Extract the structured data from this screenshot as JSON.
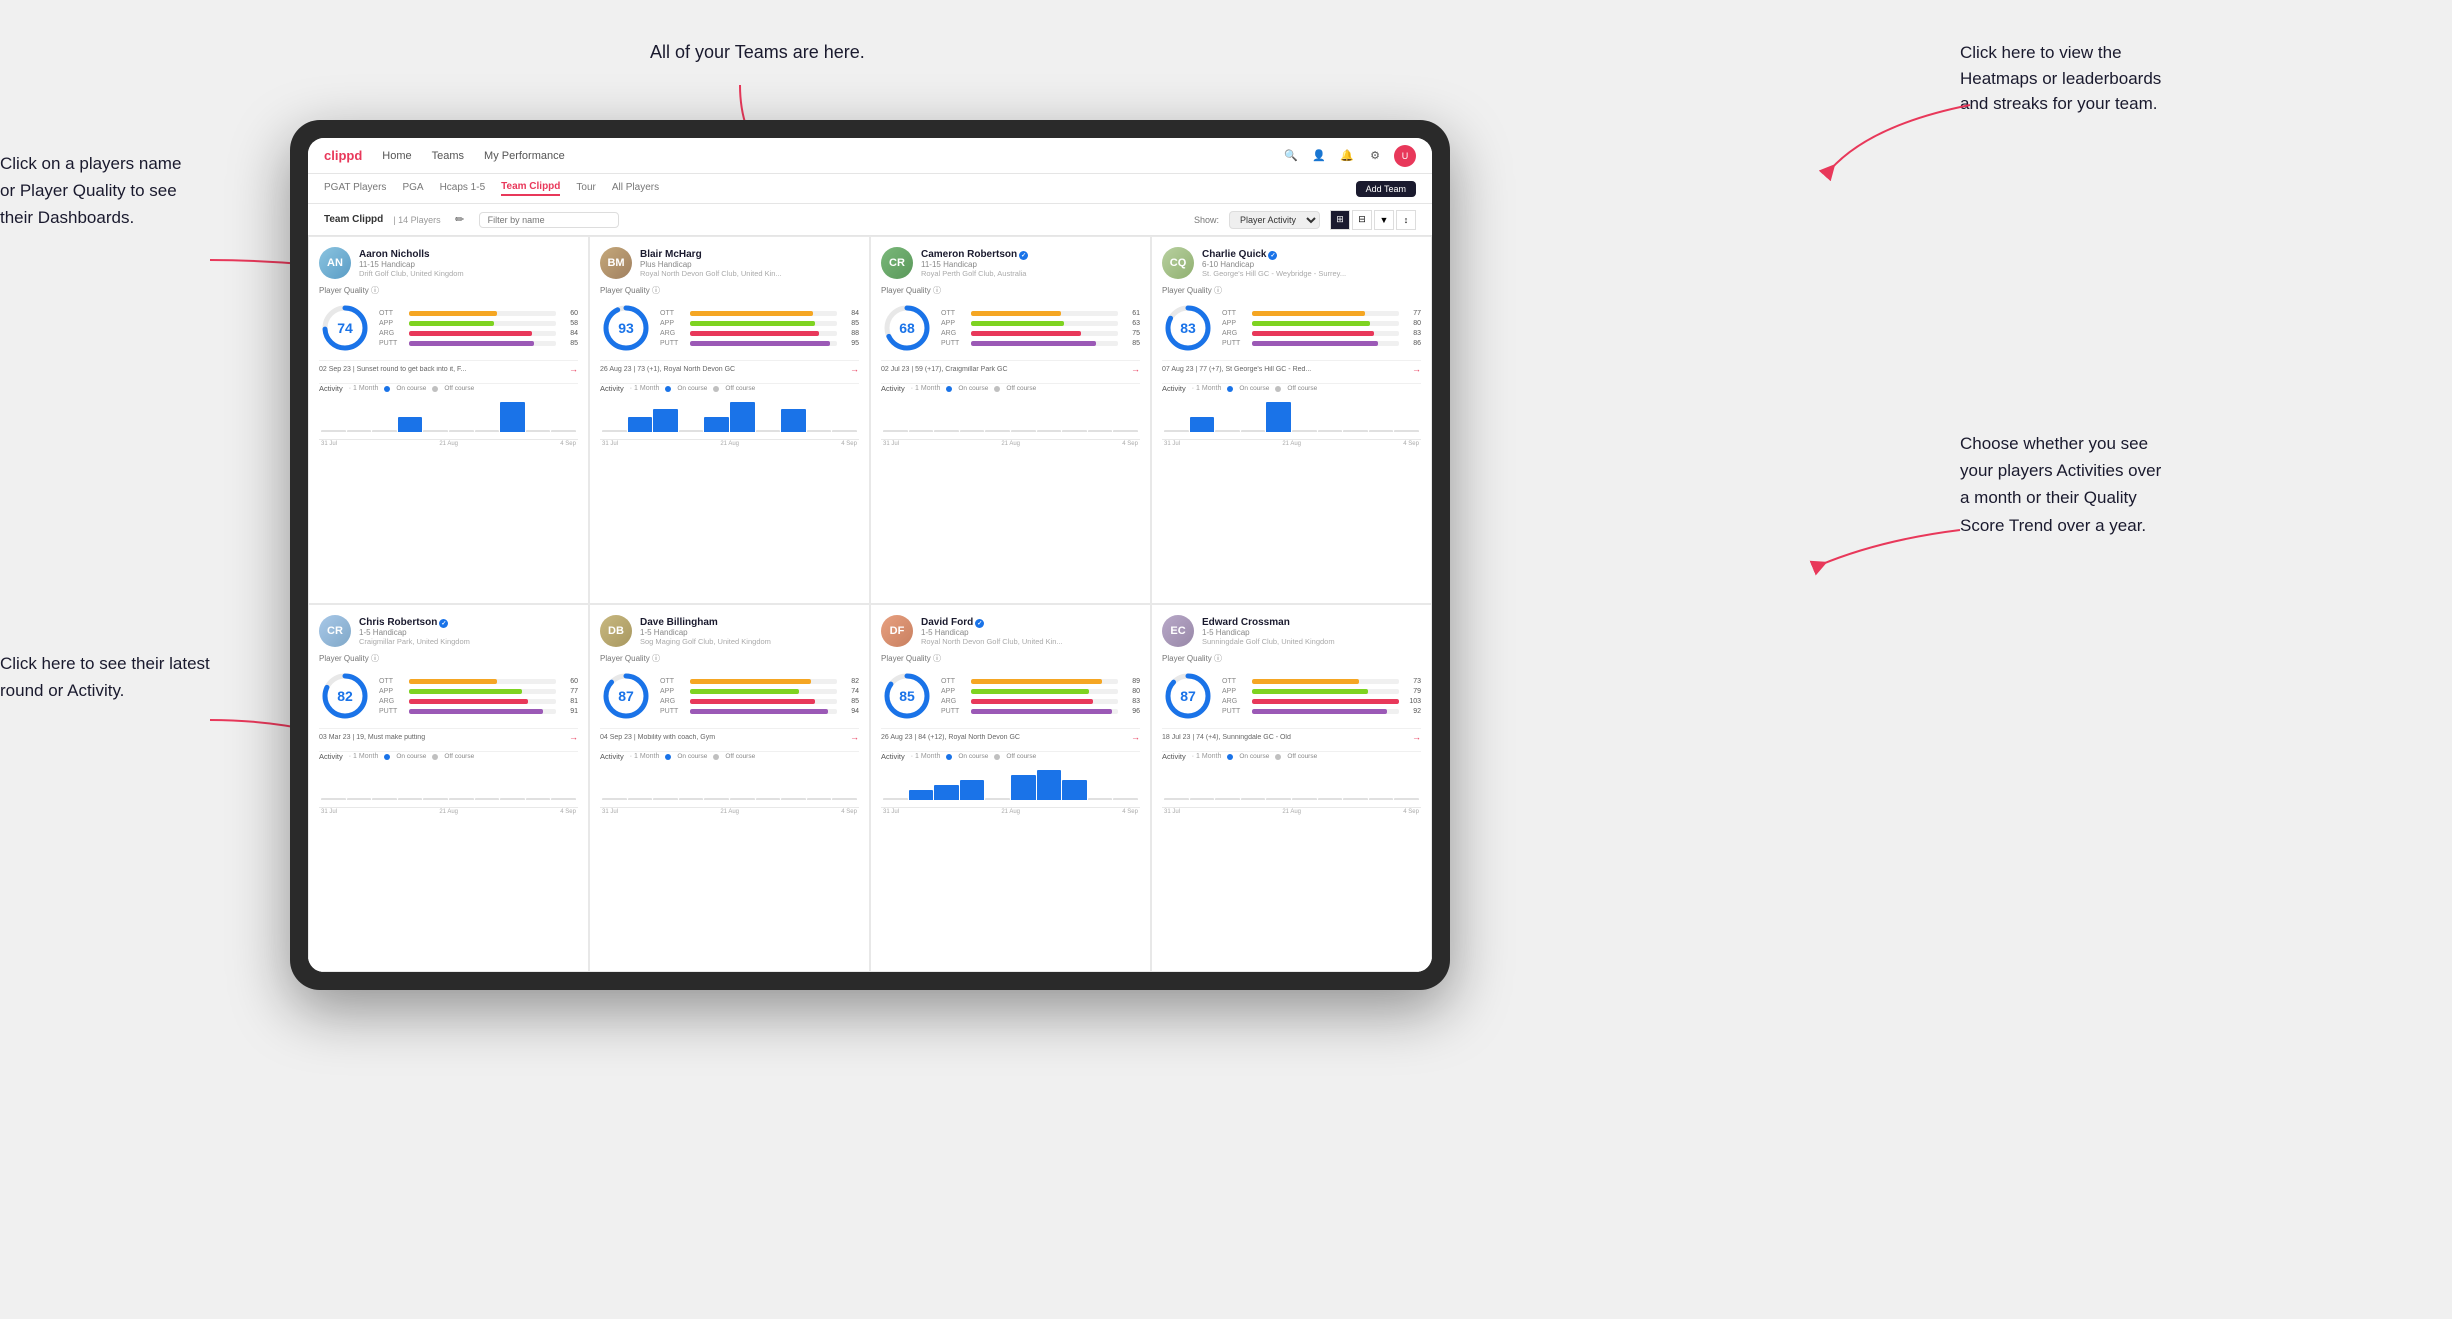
{
  "annotations": {
    "teams_tip": "All of your Teams are here.",
    "heatmap_tip": "Click here to view the\nHeatmaps or leaderboards\nand streaks for your team.",
    "players_tip": "Click on a players name\nor Player Quality to see\ntheir Dashboards.",
    "round_tip": "Click here to see their latest\nround or Activity.",
    "activities_tip": "Choose whether you see\nyour players Activities over\na month or their Quality\nScore Trend over a year."
  },
  "nav": {
    "logo": "clippd",
    "items": [
      "Home",
      "Teams",
      "My Performance"
    ],
    "icons": [
      "search",
      "person",
      "bell",
      "settings",
      "avatar"
    ]
  },
  "subNav": {
    "tabs": [
      "PGAT Players",
      "PGA",
      "Hcaps 1-5",
      "Team Clippd",
      "Tour",
      "All Players"
    ],
    "activeTab": "Team Clippd",
    "addTeamLabel": "Add Team"
  },
  "teamHeader": {
    "title": "Team Clippd",
    "separator": "|",
    "count": "14 Players",
    "filterPlaceholder": "Filter by name",
    "showLabel": "Show:",
    "showOption": "Player Activity",
    "viewOptions": [
      "grid-large",
      "grid-small",
      "filter",
      "sort"
    ]
  },
  "players": [
    {
      "name": "Aaron Nicholls",
      "handicap": "11-15 Handicap",
      "club": "Drift Golf Club, United Kingdom",
      "quality": 74,
      "quality_color": "#1a73e8",
      "ott": 60,
      "app": 58,
      "arg": 84,
      "putt": 85,
      "recent": "02 Sep 23 | Sunset round to get back into it, F...",
      "activity_bars": [
        0,
        0,
        0,
        1,
        0,
        0,
        0,
        2,
        0,
        0
      ],
      "chart_labels": [
        "31 Jul",
        "21 Aug",
        "4 Sep"
      ],
      "avatar_class": "av-aaron",
      "initials": "AN",
      "verified": false
    },
    {
      "name": "Blair McHarg",
      "handicap": "Plus Handicap",
      "club": "Royal North Devon Golf Club, United Kin...",
      "quality": 93,
      "quality_color": "#1a73e8",
      "ott": 84,
      "app": 85,
      "arg": 88,
      "putt": 95,
      "recent": "26 Aug 23 | 73 (+1), Royal North Devon GC",
      "activity_bars": [
        0,
        2,
        3,
        0,
        2,
        4,
        0,
        3,
        0,
        0
      ],
      "chart_labels": [
        "31 Jul",
        "21 Aug",
        "4 Sep"
      ],
      "avatar_class": "av-blair",
      "initials": "BM",
      "verified": false
    },
    {
      "name": "Cameron Robertson",
      "handicap": "11-15 Handicap",
      "club": "Royal Perth Golf Club, Australia",
      "quality": 68,
      "quality_color": "#1a73e8",
      "ott": 61,
      "app": 63,
      "arg": 75,
      "putt": 85,
      "recent": "02 Jul 23 | 59 (+17), Craigmillar Park GC",
      "activity_bars": [
        0,
        0,
        0,
        0,
        0,
        0,
        0,
        0,
        0,
        0
      ],
      "chart_labels": [
        "31 Jul",
        "21 Aug",
        "4 Sep"
      ],
      "avatar_class": "av-cameron",
      "initials": "CR",
      "verified": true
    },
    {
      "name": "Charlie Quick",
      "handicap": "6-10 Handicap",
      "club": "St. George's Hill GC - Weybridge - Surrey...",
      "quality": 83,
      "quality_color": "#1a73e8",
      "ott": 77,
      "app": 80,
      "arg": 83,
      "putt": 86,
      "recent": "07 Aug 23 | 77 (+7), St George's Hill GC - Red...",
      "activity_bars": [
        0,
        1,
        0,
        0,
        2,
        0,
        0,
        0,
        0,
        0
      ],
      "chart_labels": [
        "31 Jul",
        "21 Aug",
        "4 Sep"
      ],
      "avatar_class": "av-charlie",
      "initials": "CQ",
      "verified": true
    },
    {
      "name": "Chris Robertson",
      "handicap": "1-5 Handicap",
      "club": "Craigmillar Park, United Kingdom",
      "quality": 82,
      "quality_color": "#1a73e8",
      "ott": 60,
      "app": 77,
      "arg": 81,
      "putt": 91,
      "recent": "03 Mar 23 | 19, Must make putting",
      "activity_bars": [
        0,
        0,
        0,
        0,
        0,
        0,
        0,
        0,
        0,
        0
      ],
      "chart_labels": [
        "31 Jul",
        "21 Aug",
        "4 Sep"
      ],
      "avatar_class": "av-chris",
      "initials": "CR",
      "verified": true
    },
    {
      "name": "Dave Billingham",
      "handicap": "1-5 Handicap",
      "club": "Sog Maging Golf Club, United Kingdom",
      "quality": 87,
      "quality_color": "#1a73e8",
      "ott": 82,
      "app": 74,
      "arg": 85,
      "putt": 94,
      "recent": "04 Sep 23 | Mobility with coach, Gym",
      "activity_bars": [
        0,
        0,
        0,
        0,
        0,
        0,
        0,
        0,
        0,
        0
      ],
      "chart_labels": [
        "31 Jul",
        "21 Aug",
        "4 Sep"
      ],
      "avatar_class": "av-dave",
      "initials": "DB",
      "verified": false
    },
    {
      "name": "David Ford",
      "handicap": "1-5 Handicap",
      "club": "Royal North Devon Golf Club, United Kin...",
      "quality": 85,
      "quality_color": "#1a73e8",
      "ott": 89,
      "app": 80,
      "arg": 83,
      "putt": 96,
      "recent": "26 Aug 23 | 84 (+12), Royal North Devon GC",
      "activity_bars": [
        0,
        2,
        3,
        4,
        0,
        5,
        6,
        4,
        0,
        0
      ],
      "chart_labels": [
        "31 Jul",
        "21 Aug",
        "4 Sep"
      ],
      "avatar_class": "av-david",
      "initials": "DF",
      "verified": true
    },
    {
      "name": "Edward Crossman",
      "handicap": "1-5 Handicap",
      "club": "Sunningdale Golf Club, United Kingdom",
      "quality": 87,
      "quality_color": "#1a73e8",
      "ott": 73,
      "app": 79,
      "arg": 103,
      "putt": 92,
      "recent": "18 Jul 23 | 74 (+4), Sunningdale GC - Old",
      "activity_bars": [
        0,
        0,
        0,
        0,
        0,
        0,
        0,
        0,
        0,
        0
      ],
      "chart_labels": [
        "31 Jul",
        "21 Aug",
        "4 Sep"
      ],
      "avatar_class": "av-edward",
      "initials": "EC",
      "verified": false
    }
  ],
  "activityChart": {
    "title": "Activity",
    "period": "· 1 Month",
    "onCourseLabel": "On course",
    "offCourseLabel": "Off course",
    "onCourseColor": "#1a73e8",
    "offCourseColor": "#e8e8e8"
  },
  "statColors": {
    "ott": "#f5a623",
    "app": "#7ed321",
    "arg": "#e8385a",
    "putt": "#9b59b6"
  }
}
